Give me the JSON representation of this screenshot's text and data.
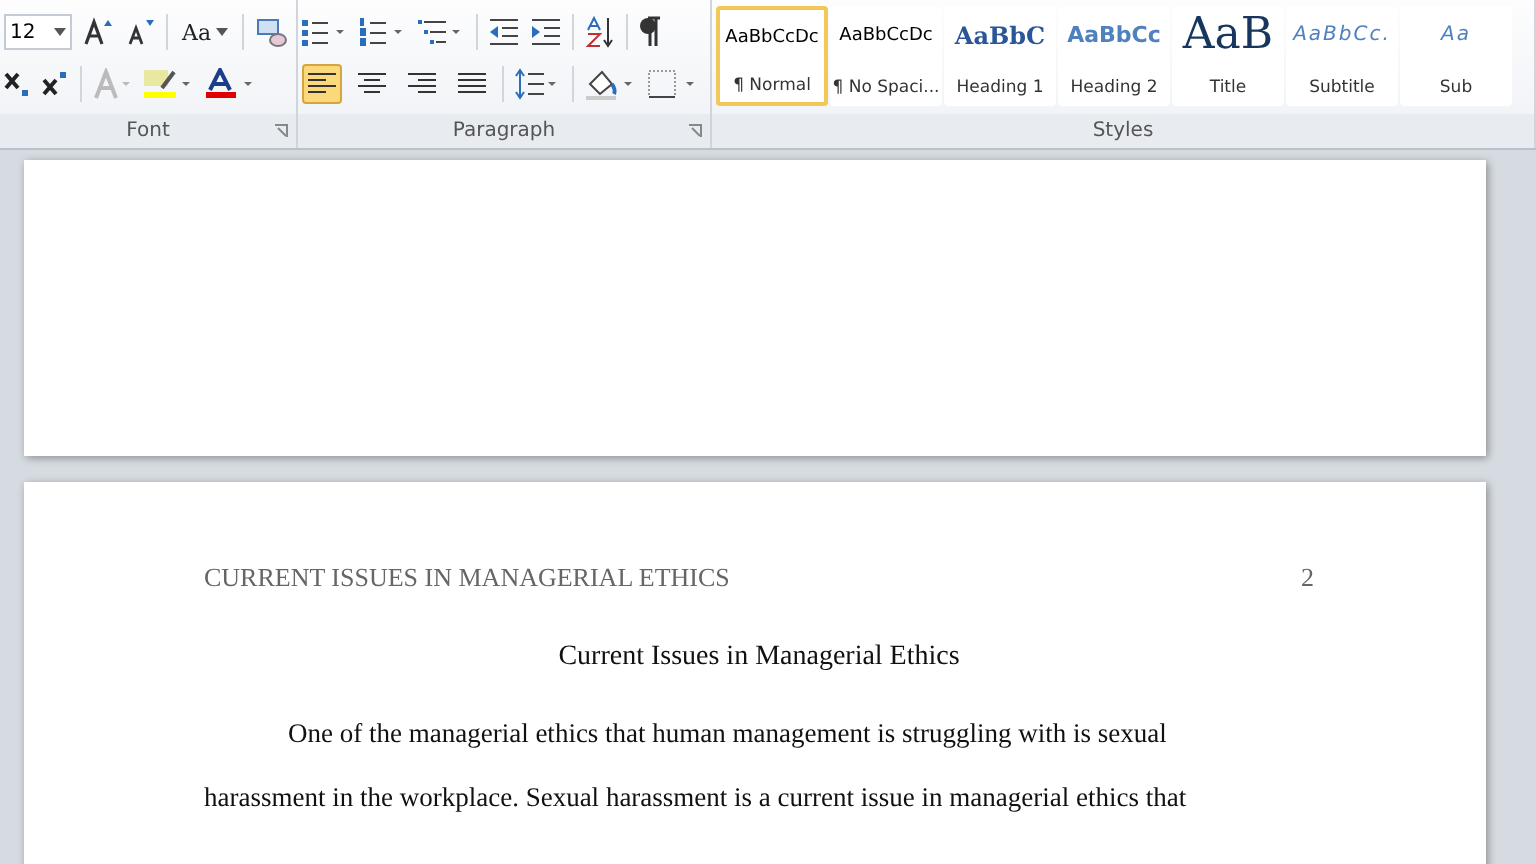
{
  "ribbon": {
    "font": {
      "size": "12",
      "change_case": "Aa",
      "label": "Font"
    },
    "paragraph": {
      "label": "Paragraph",
      "alignments": [
        {
          "kind": "left",
          "selected": true
        },
        {
          "kind": "center",
          "selected": false
        },
        {
          "kind": "right",
          "selected": false
        },
        {
          "kind": "justify",
          "selected": false
        }
      ]
    },
    "styles": {
      "label": "Styles",
      "items": [
        {
          "preview": "AaBbCcDc",
          "name": "¶ Normal",
          "kind": "normal",
          "selected": true
        },
        {
          "preview": "AaBbCcDc",
          "name": "¶ No Spaci...",
          "kind": "normal",
          "selected": false
        },
        {
          "preview": "AaBbC",
          "name": "Heading 1",
          "kind": "heading1",
          "selected": false
        },
        {
          "preview": "AaBbCc",
          "name": "Heading 2",
          "kind": "heading2",
          "selected": false
        },
        {
          "preview": "AaB",
          "name": "Title",
          "kind": "title",
          "selected": false
        },
        {
          "preview": "AaBbCc.",
          "name": "Subtitle",
          "kind": "subtitle",
          "selected": false
        },
        {
          "preview": "Aa",
          "name": "Sub",
          "kind": "subtitle",
          "selected": false
        }
      ]
    }
  },
  "document": {
    "page_header": "CURRENT ISSUES IN MANAGERIAL ETHICS",
    "page_number": "2",
    "title": "Current Issues in Managerial Ethics",
    "paragraph": "One of the managerial ethics that human management is struggling with is sexual harassment in the workplace. Sexual harassment is a current issue in managerial ethics that"
  }
}
